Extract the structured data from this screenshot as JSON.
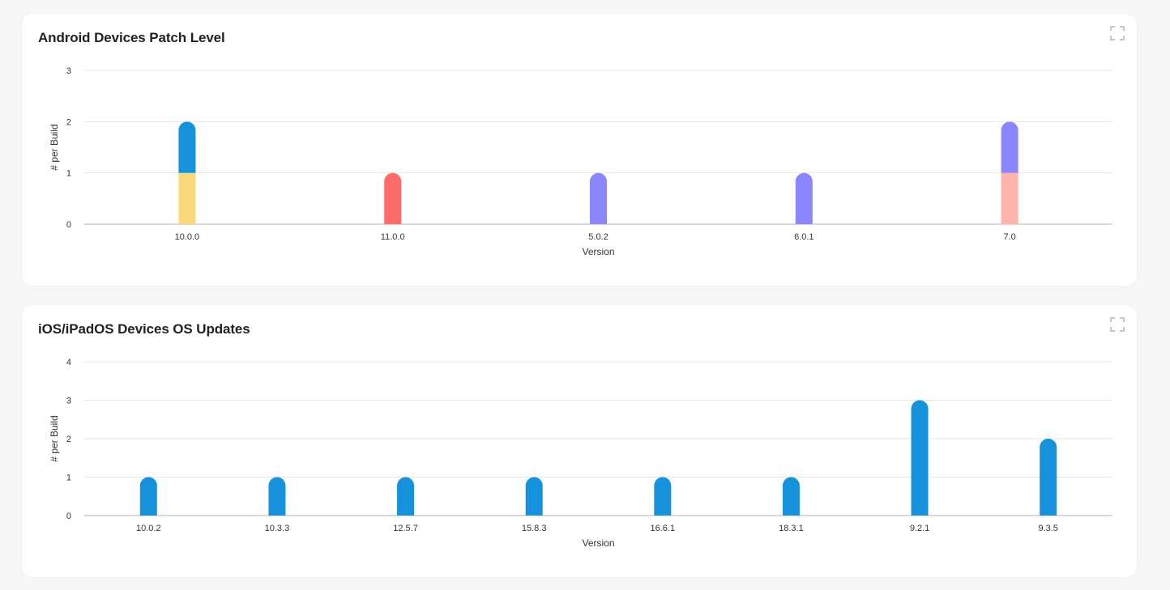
{
  "colors": {
    "blue": "#1592db",
    "yellow": "#f9d97c",
    "red": "#ff6b6b",
    "purple": "#8b86ff",
    "pink": "#ffb3aa",
    "grid": "#e6e6e6",
    "axis": "#b5b5b5"
  },
  "cards": [
    {
      "title": "Android Devices Patch Level",
      "expand_icon": "expand-icon",
      "chart_data": {
        "type": "bar",
        "stacked": true,
        "categories": [
          "10.0.0",
          "11.0.0",
          "5.0.2",
          "6.0.1",
          "7.0"
        ],
        "stacks": [
          [
            {
              "value": 1,
              "color": "#f9d97c"
            },
            {
              "value": 1,
              "color": "#1592db"
            }
          ],
          [
            {
              "value": 1,
              "color": "#ff6b6b"
            }
          ],
          [
            {
              "value": 1,
              "color": "#8b86ff"
            }
          ],
          [
            {
              "value": 1,
              "color": "#8b86ff"
            }
          ],
          [
            {
              "value": 1,
              "color": "#ffb3aa"
            },
            {
              "value": 1,
              "color": "#8b86ff"
            }
          ]
        ],
        "xlabel": "Version",
        "ylabel": "# per Build",
        "ylim": [
          0,
          3
        ],
        "yticks": [
          0,
          1,
          2,
          3
        ],
        "grid": true,
        "legend": "none"
      }
    },
    {
      "title": "iOS/iPadOS Devices OS Updates",
      "expand_icon": "expand-icon",
      "chart_data": {
        "type": "bar",
        "stacked": true,
        "categories": [
          "10.0.2",
          "10.3.3",
          "12.5.7",
          "15.8.3",
          "16.6.1",
          "18.3.1",
          "9.2.1",
          "9.3.5"
        ],
        "stacks": [
          [
            {
              "value": 1,
              "color": "#1592db"
            }
          ],
          [
            {
              "value": 1,
              "color": "#1592db"
            }
          ],
          [
            {
              "value": 1,
              "color": "#1592db"
            }
          ],
          [
            {
              "value": 1,
              "color": "#1592db"
            }
          ],
          [
            {
              "value": 1,
              "color": "#1592db"
            }
          ],
          [
            {
              "value": 1,
              "color": "#1592db"
            }
          ],
          [
            {
              "value": 3,
              "color": "#1592db"
            }
          ],
          [
            {
              "value": 2,
              "color": "#1592db"
            }
          ]
        ],
        "xlabel": "Version",
        "ylabel": "# per Build",
        "ylim": [
          0,
          4
        ],
        "yticks": [
          0,
          1,
          2,
          3,
          4
        ],
        "grid": true,
        "legend": "none"
      }
    }
  ]
}
